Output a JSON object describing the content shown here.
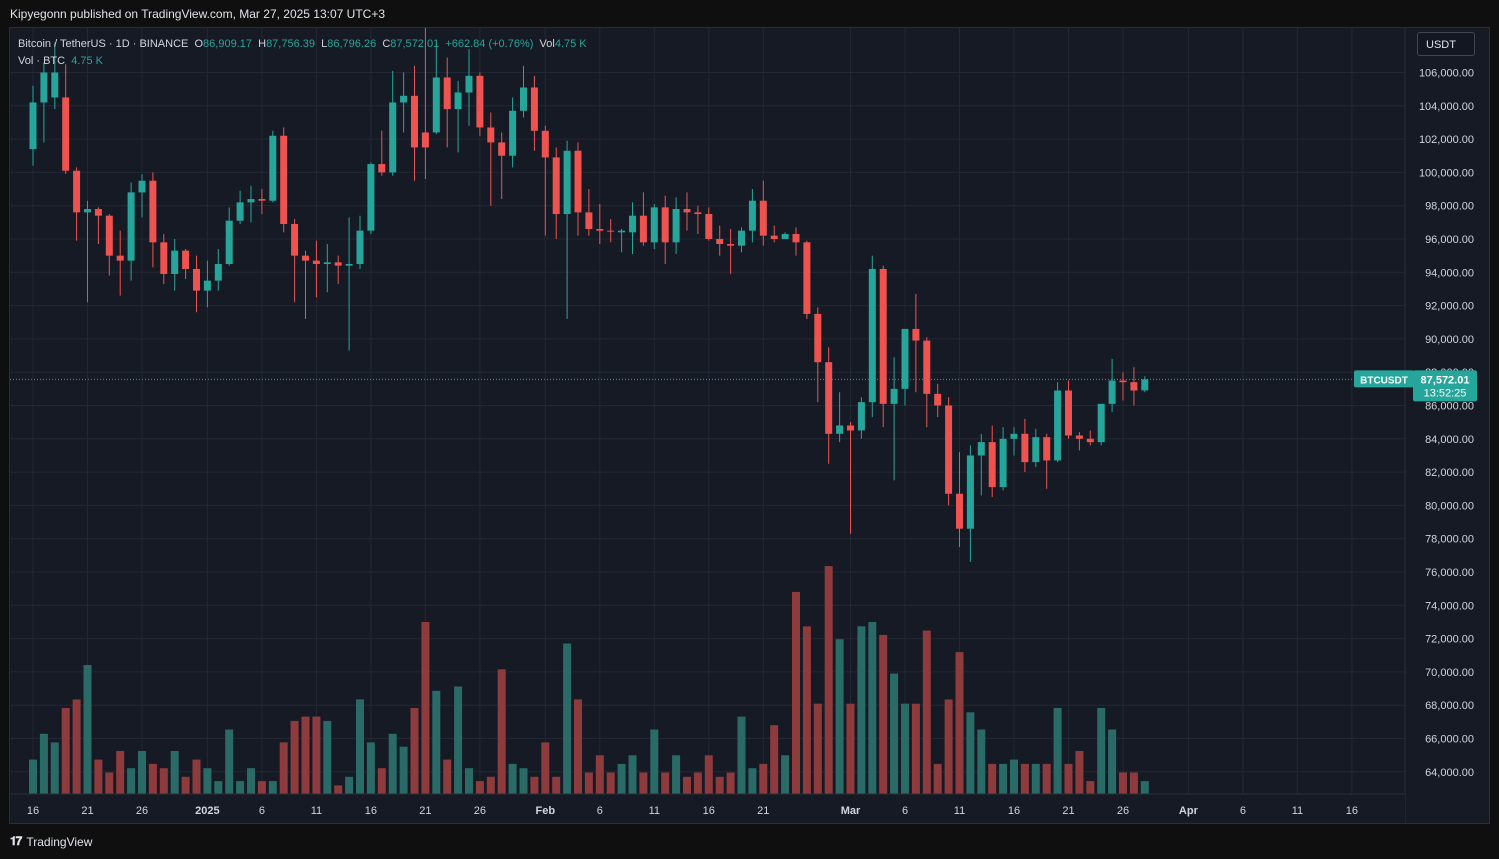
{
  "header": {
    "published_text": "Kipyegonn published on TradingView.com, Mar 27, 2025 13:07 UTC+3"
  },
  "legend": {
    "symbol": "Bitcoin / TetherUS · 1D · BINANCE",
    "o_label": "O",
    "o_value": "86,909.17",
    "h_label": "H",
    "h_value": "87,756.39",
    "l_label": "L",
    "l_value": "86,796.26",
    "c_label": "C",
    "c_value": "87,572.01",
    "change": "+662.84 (+0.76%)",
    "vol_label": "Vol",
    "vol_value": "4.75 K",
    "vol_line_label": "Vol · BTC",
    "vol_line_value": "4.75 K"
  },
  "currency": "USDT",
  "price_badge": {
    "ticker": "BTCUSDT",
    "price": "87,572.01",
    "countdown": "13:52:25"
  },
  "footer": {
    "brand": "TradingView",
    "logo_icon": "tradingview-logo-icon"
  },
  "colors": {
    "up": "#26a69a",
    "down": "#ef5350",
    "vol_up": "#2a6b68",
    "vol_down": "#8e3b3d",
    "grid": "#232734",
    "bg": "#161a25"
  },
  "chart_data": {
    "type": "candlestick",
    "y_ticks": [
      "106,000.00",
      "104,000.00",
      "102,000.00",
      "100,000.00",
      "98,000.00",
      "96,000.00",
      "94,000.00",
      "92,000.00",
      "90,000.00",
      "88,000.00",
      "86,000.00",
      "84,000.00",
      "82,000.00",
      "80,000.00",
      "78,000.00",
      "76,000.00",
      "74,000.00",
      "72,000.00",
      "70,000.00",
      "68,000.00",
      "66,000.00",
      "64,000.00"
    ],
    "y_tick_values": [
      106000,
      104000,
      102000,
      100000,
      98000,
      96000,
      94000,
      92000,
      90000,
      88000,
      86000,
      84000,
      82000,
      80000,
      78000,
      76000,
      74000,
      72000,
      70000,
      68000,
      66000,
      64000
    ],
    "x_ticks": [
      {
        "label": "16",
        "day": 0
      },
      {
        "label": "21",
        "day": 5
      },
      {
        "label": "26",
        "day": 10
      },
      {
        "label": "2025",
        "day": 16
      },
      {
        "label": "6",
        "day": 21
      },
      {
        "label": "11",
        "day": 26
      },
      {
        "label": "16",
        "day": 31
      },
      {
        "label": "21",
        "day": 36
      },
      {
        "label": "26",
        "day": 41
      },
      {
        "label": "Feb",
        "day": 47
      },
      {
        "label": "6",
        "day": 52
      },
      {
        "label": "11",
        "day": 57
      },
      {
        "label": "16",
        "day": 62
      },
      {
        "label": "21",
        "day": 67
      },
      {
        "label": "Mar",
        "day": 75
      },
      {
        "label": "6",
        "day": 80
      },
      {
        "label": "11",
        "day": 85
      },
      {
        "label": "16",
        "day": 90
      },
      {
        "label": "21",
        "day": 95
      },
      {
        "label": "26",
        "day": 100
      },
      {
        "label": "Apr",
        "day": 106
      },
      {
        "label": "6",
        "day": 111
      },
      {
        "label": "11",
        "day": 116
      },
      {
        "label": "16",
        "day": 121
      }
    ],
    "bold_x_ticks": [
      "2025",
      "Feb",
      "Mar",
      "Apr"
    ],
    "first_day": "Dec 15, 2024",
    "last_price": 87572.01,
    "candles": [
      [
        101400,
        105200,
        100400,
        104200,
        "up"
      ],
      [
        104200,
        106600,
        101800,
        106000,
        "up"
      ],
      [
        106000,
        107800,
        103800,
        104500,
        "up"
      ],
      [
        104500,
        106500,
        99900,
        100100,
        "down"
      ],
      [
        100100,
        100300,
        95900,
        97600,
        "down"
      ],
      [
        97600,
        98300,
        92200,
        97800,
        "up"
      ],
      [
        97800,
        97900,
        95700,
        97400,
        "down"
      ],
      [
        97400,
        97500,
        93800,
        95000,
        "down"
      ],
      [
        95000,
        96500,
        92600,
        94700,
        "down"
      ],
      [
        94700,
        99400,
        93500,
        98800,
        "up"
      ],
      [
        98800,
        99900,
        97300,
        99500,
        "up"
      ],
      [
        99500,
        100000,
        94300,
        95800,
        "down"
      ],
      [
        95800,
        96300,
        93300,
        93900,
        "down"
      ],
      [
        93900,
        96000,
        92900,
        95300,
        "up"
      ],
      [
        95300,
        95400,
        93600,
        94200,
        "down"
      ],
      [
        94200,
        95000,
        91600,
        92900,
        "down"
      ],
      [
        92900,
        94700,
        91900,
        93500,
        "up"
      ],
      [
        93500,
        95400,
        92900,
        94500,
        "up"
      ],
      [
        94500,
        97900,
        94400,
        97100,
        "up"
      ],
      [
        97100,
        98900,
        96900,
        98200,
        "up"
      ],
      [
        98200,
        99200,
        97000,
        98400,
        "up"
      ],
      [
        98400,
        99000,
        97500,
        98300,
        "down"
      ],
      [
        98300,
        102500,
        98200,
        102200,
        "up"
      ],
      [
        102200,
        102700,
        96400,
        96900,
        "down"
      ],
      [
        96900,
        97200,
        92200,
        95000,
        "down"
      ],
      [
        95000,
        95300,
        91200,
        94700,
        "down"
      ],
      [
        94700,
        95900,
        92500,
        94500,
        "down"
      ],
      [
        94500,
        95700,
        92800,
        94600,
        "up"
      ],
      [
        94600,
        95000,
        93300,
        94400,
        "down"
      ],
      [
        94400,
        97300,
        89300,
        94500,
        "up"
      ],
      [
        94500,
        97400,
        94200,
        96500,
        "up"
      ],
      [
        96500,
        100600,
        96300,
        100500,
        "up"
      ],
      [
        100500,
        102500,
        99800,
        100000,
        "down"
      ],
      [
        100000,
        106100,
        99800,
        104200,
        "up"
      ],
      [
        104200,
        106000,
        102400,
        104600,
        "up"
      ],
      [
        104600,
        106400,
        99500,
        101500,
        "down"
      ],
      [
        101500,
        109600,
        99600,
        102400,
        "down"
      ],
      [
        102400,
        107800,
        102300,
        105700,
        "up"
      ],
      [
        105700,
        106900,
        101500,
        103800,
        "down"
      ],
      [
        103800,
        105500,
        101200,
        104800,
        "up"
      ],
      [
        104800,
        107400,
        102800,
        105800,
        "up"
      ],
      [
        105800,
        106000,
        102200,
        102700,
        "down"
      ],
      [
        102700,
        103600,
        98000,
        101800,
        "down"
      ],
      [
        101800,
        102400,
        98400,
        101000,
        "down"
      ],
      [
        101000,
        104500,
        100300,
        103700,
        "up"
      ],
      [
        103700,
        106400,
        103300,
        105100,
        "up"
      ],
      [
        105100,
        105800,
        101300,
        102500,
        "down"
      ],
      [
        102500,
        102800,
        96200,
        100900,
        "down"
      ],
      [
        100900,
        101500,
        96000,
        97500,
        "down"
      ],
      [
        97500,
        101900,
        91200,
        101300,
        "up"
      ],
      [
        101300,
        101800,
        96200,
        97600,
        "down"
      ],
      [
        97600,
        99000,
        96200,
        96600,
        "down"
      ],
      [
        96600,
        98100,
        95700,
        96500,
        "down"
      ],
      [
        96500,
        97200,
        95800,
        96500,
        "down"
      ],
      [
        96500,
        96600,
        95200,
        96400,
        "up"
      ],
      [
        96400,
        98200,
        95100,
        97400,
        "up"
      ],
      [
        97400,
        98800,
        95600,
        95800,
        "down"
      ],
      [
        95800,
        98100,
        95400,
        97900,
        "up"
      ],
      [
        97900,
        98600,
        94500,
        95800,
        "down"
      ],
      [
        95800,
        98500,
        95100,
        97800,
        "up"
      ],
      [
        97800,
        98800,
        96500,
        97600,
        "down"
      ],
      [
        97600,
        98000,
        96300,
        97500,
        "down"
      ],
      [
        97500,
        97900,
        95900,
        96000,
        "down"
      ],
      [
        96000,
        96800,
        95000,
        95700,
        "down"
      ],
      [
        95700,
        96600,
        93900,
        95600,
        "down"
      ],
      [
        95600,
        96700,
        95200,
        96500,
        "up"
      ],
      [
        96500,
        99000,
        95800,
        98300,
        "up"
      ],
      [
        98300,
        99500,
        95600,
        96200,
        "down"
      ],
      [
        96200,
        96800,
        95800,
        96000,
        "down"
      ],
      [
        96000,
        96400,
        96000,
        96300,
        "up"
      ],
      [
        96300,
        96700,
        95000,
        95800,
        "down"
      ],
      [
        95800,
        95900,
        91200,
        91500,
        "down"
      ],
      [
        91500,
        91900,
        86200,
        88600,
        "down"
      ],
      [
        88600,
        89500,
        82500,
        84300,
        "down"
      ],
      [
        84300,
        86800,
        83800,
        84800,
        "up"
      ],
      [
        84800,
        85000,
        78300,
        84500,
        "down"
      ],
      [
        84500,
        86500,
        84000,
        86200,
        "up"
      ],
      [
        86200,
        95000,
        85300,
        94200,
        "up"
      ],
      [
        94200,
        94400,
        84700,
        86100,
        "down"
      ],
      [
        86100,
        88900,
        81500,
        87000,
        "up"
      ],
      [
        87000,
        90400,
        86000,
        90600,
        "up"
      ],
      [
        90600,
        92700,
        86800,
        89900,
        "down"
      ],
      [
        89900,
        90100,
        84700,
        86700,
        "down"
      ],
      [
        86700,
        87300,
        85300,
        86000,
        "down"
      ],
      [
        86000,
        86500,
        80000,
        80700,
        "down"
      ],
      [
        80700,
        83200,
        77500,
        78600,
        "down"
      ],
      [
        78600,
        83600,
        76600,
        83000,
        "up"
      ],
      [
        83000,
        84300,
        80600,
        83800,
        "up"
      ],
      [
        83800,
        84800,
        80500,
        81100,
        "down"
      ],
      [
        81100,
        84700,
        80900,
        84000,
        "up"
      ],
      [
        84000,
        84700,
        83000,
        84300,
        "up"
      ],
      [
        84300,
        85200,
        82000,
        82600,
        "down"
      ],
      [
        82600,
        84600,
        82300,
        84100,
        "up"
      ],
      [
        84100,
        84300,
        81000,
        82700,
        "down"
      ],
      [
        82700,
        87400,
        82600,
        86900,
        "up"
      ],
      [
        86900,
        87500,
        84000,
        84200,
        "down"
      ],
      [
        84200,
        84400,
        83300,
        84000,
        "down"
      ],
      [
        84000,
        84500,
        83600,
        83800,
        "down"
      ],
      [
        83800,
        86000,
        83600,
        86100,
        "up"
      ],
      [
        86100,
        88800,
        85600,
        87500,
        "up"
      ],
      [
        87500,
        88000,
        86300,
        87400,
        "down"
      ],
      [
        87400,
        88300,
        86000,
        86900,
        "down"
      ],
      [
        86909.17,
        87756.39,
        86796.26,
        87572.01,
        "up"
      ]
    ],
    "volumes_k": [
      8,
      14,
      12,
      20,
      22,
      30,
      8,
      5,
      10,
      6,
      10,
      7,
      6,
      10,
      4,
      8,
      6,
      3,
      15,
      3,
      6,
      3,
      3,
      12,
      17,
      18,
      18,
      17,
      2,
      4,
      22,
      12,
      6,
      14,
      11,
      20,
      40,
      24,
      8,
      25,
      6,
      3,
      4,
      29,
      7,
      6,
      4,
      12,
      4,
      35,
      22,
      5,
      9,
      5,
      7,
      9,
      5,
      15,
      5,
      9,
      4,
      5,
      9,
      4,
      5,
      18,
      6,
      7,
      16,
      9,
      47,
      39,
      21,
      53,
      36,
      21,
      39,
      40,
      37,
      28,
      21,
      21,
      38,
      7,
      22,
      33,
      19,
      15,
      7,
      7,
      8,
      7,
      7,
      7,
      20,
      7,
      10,
      3,
      20,
      15,
      5,
      5,
      3
    ]
  }
}
